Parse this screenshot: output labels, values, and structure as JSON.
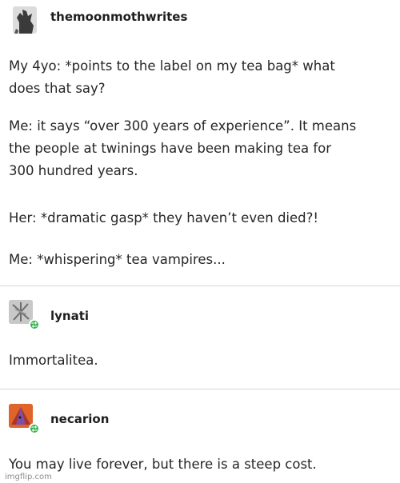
{
  "original_post": {
    "username": "themoonmothwrites",
    "paragraphs": [
      {
        "lines": [
          "My 4yo: *points to the label on my tea bag* what",
          "does that say?"
        ]
      },
      {
        "lines": [
          "Me: it says “over 300 years of experience”. It means",
          "the people at twinings have been making tea for",
          "300 hundred years."
        ]
      },
      {
        "lines": [
          "Her: *dramatic gasp* they haven’t even died?!"
        ]
      },
      {
        "lines": [
          "Me: *whispering* tea vampires..."
        ]
      }
    ]
  },
  "replies": [
    {
      "username": "lynati",
      "text": "Immortalitea."
    },
    {
      "username": "necarion",
      "text": "You may live forever, but there is a steep cost."
    }
  ],
  "watermark": "imgflip.com",
  "colors": {
    "text": "#262626",
    "divider": "#d6d6d6",
    "reblog_badge": "#2fb34a"
  },
  "icons": {
    "avatar_1": "dark-figure-avatar-icon",
    "avatar_2": "gray-x-avatar-icon",
    "avatar_3": "orange-triangle-avatar-icon",
    "badge": "reblog-icon"
  }
}
